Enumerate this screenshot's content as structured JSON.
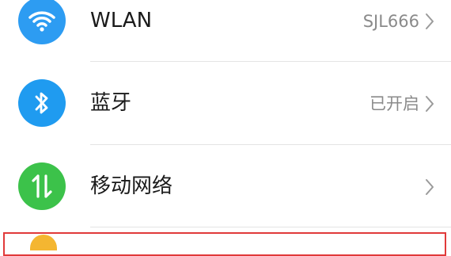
{
  "colors": {
    "wlan_icon_bg": "#2d9cf2",
    "bluetooth_icon_bg": "#1f9bf0",
    "mobile_network_icon_bg": "#3cc24a",
    "partial_icon_bg": "#f4b631",
    "highlight_border": "#e13a3a"
  },
  "settings": {
    "wlan": {
      "label": "WLAN",
      "value": "SJL666",
      "icon": "wifi-icon"
    },
    "bluetooth": {
      "label": "蓝牙",
      "value": "已开启",
      "icon": "bluetooth-icon"
    },
    "mobile_network": {
      "label": "移动网络",
      "value": "",
      "icon": "mobile-data-icon"
    }
  }
}
